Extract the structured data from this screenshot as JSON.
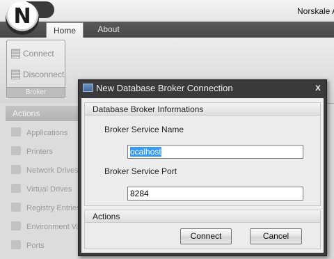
{
  "app": {
    "logo_letter": "N",
    "window_title": "Norskale A"
  },
  "tabs": [
    {
      "label": "Home"
    },
    {
      "label": "About"
    }
  ],
  "ribbon": {
    "group": {
      "buttons": [
        {
          "label": "Connect",
          "icon": "database-icon"
        },
        {
          "label": "Disconnect",
          "icon": "database-disconnect-icon"
        }
      ],
      "footer": "Broker"
    }
  },
  "nav": {
    "header": "Actions",
    "items": [
      {
        "label": "Applications"
      },
      {
        "label": "Printers"
      },
      {
        "label": "Network Drives"
      },
      {
        "label": "Virtual Drives"
      },
      {
        "label": "Registry Entries"
      },
      {
        "label": "Environment Va"
      },
      {
        "label": "Ports"
      }
    ]
  },
  "dialog": {
    "title": "New Database Broker Connection",
    "close_label": "x",
    "info_header": "Database Broker Informations",
    "service_name_label": "Broker Service Name",
    "service_name_value": "ocalhost",
    "service_port_label": "Broker Service Port",
    "service_port_value": "8284",
    "actions_header": "Actions",
    "connect_label": "Connect",
    "cancel_label": "Cancel"
  }
}
